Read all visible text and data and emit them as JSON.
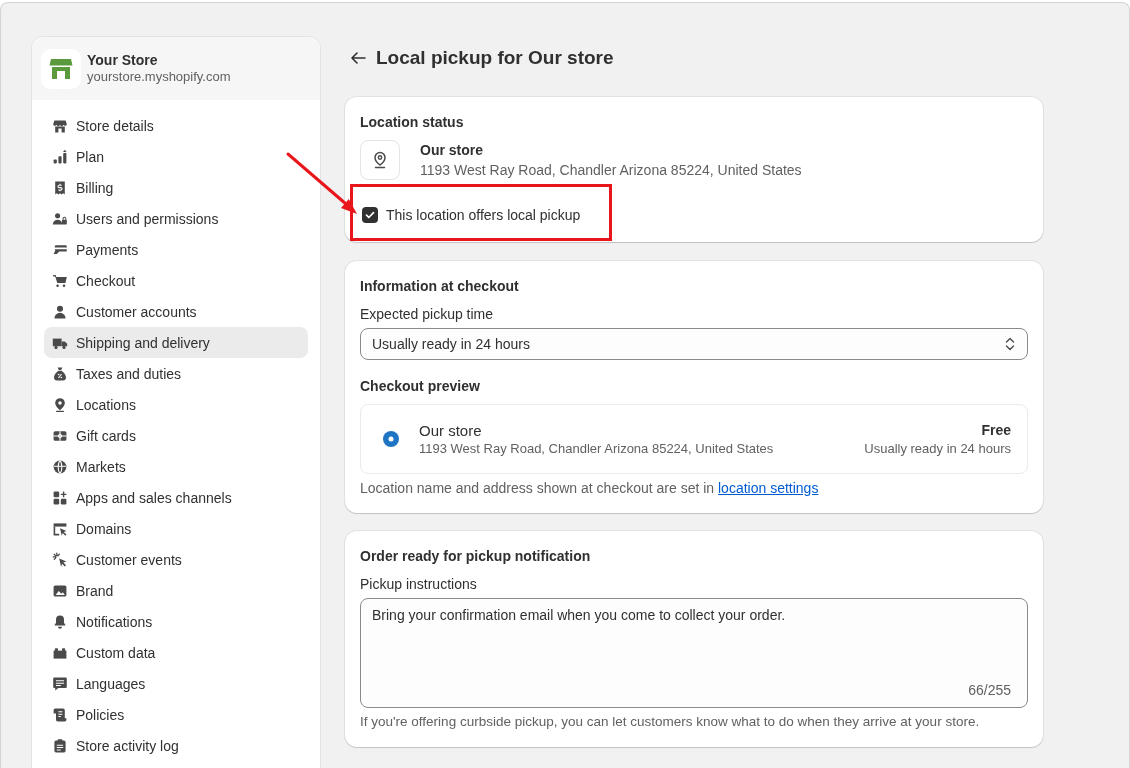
{
  "sidebar": {
    "store": {
      "name": "Your Store",
      "url": "yourstore.myshopify.com"
    },
    "items": [
      {
        "label": "Store details",
        "selected": false
      },
      {
        "label": "Plan",
        "selected": false
      },
      {
        "label": "Billing",
        "selected": false
      },
      {
        "label": "Users and permissions",
        "selected": false
      },
      {
        "label": "Payments",
        "selected": false
      },
      {
        "label": "Checkout",
        "selected": false
      },
      {
        "label": "Customer accounts",
        "selected": false
      },
      {
        "label": "Shipping and delivery",
        "selected": true
      },
      {
        "label": "Taxes and duties",
        "selected": false
      },
      {
        "label": "Locations",
        "selected": false
      },
      {
        "label": "Gift cards",
        "selected": false
      },
      {
        "label": "Markets",
        "selected": false
      },
      {
        "label": "Apps and sales channels",
        "selected": false
      },
      {
        "label": "Domains",
        "selected": false
      },
      {
        "label": "Customer events",
        "selected": false
      },
      {
        "label": "Brand",
        "selected": false
      },
      {
        "label": "Notifications",
        "selected": false
      },
      {
        "label": "Custom data",
        "selected": false
      },
      {
        "label": "Languages",
        "selected": false
      },
      {
        "label": "Policies",
        "selected": false
      },
      {
        "label": "Store activity log",
        "selected": false
      }
    ]
  },
  "page": {
    "title": "Local pickup for Our store"
  },
  "location_status": {
    "title": "Location status",
    "location_name": "Our store",
    "address": "1193 West Ray Road, Chandler Arizona 85224, United States",
    "offers_pickup": {
      "label": "This location offers local pickup",
      "checked": true
    }
  },
  "checkout_information": {
    "title": "Information at checkout",
    "pickup_time": {
      "label": "Expected pickup time",
      "value": "Usually ready in 24 hours"
    },
    "preview": {
      "title": "Checkout preview",
      "option": {
        "name": "Our store",
        "address": "1193 West Ray Road, Chandler Arizona 85224, United States",
        "selected": true,
        "price": "Free",
        "ready_time": "Usually ready in 24 hours"
      }
    },
    "note": {
      "text": "Location name and address shown at checkout are set in",
      "link": "location settings"
    }
  },
  "pickup_notification": {
    "title": "Order ready for pickup notification",
    "instructions": {
      "label": "Pickup instructions",
      "value": "Bring your confirmation email when you come to collect your order.",
      "counter": "66/255"
    },
    "help": "If you're offering curbside pickup, you can let customers know what to do when they arrive at your store."
  }
}
